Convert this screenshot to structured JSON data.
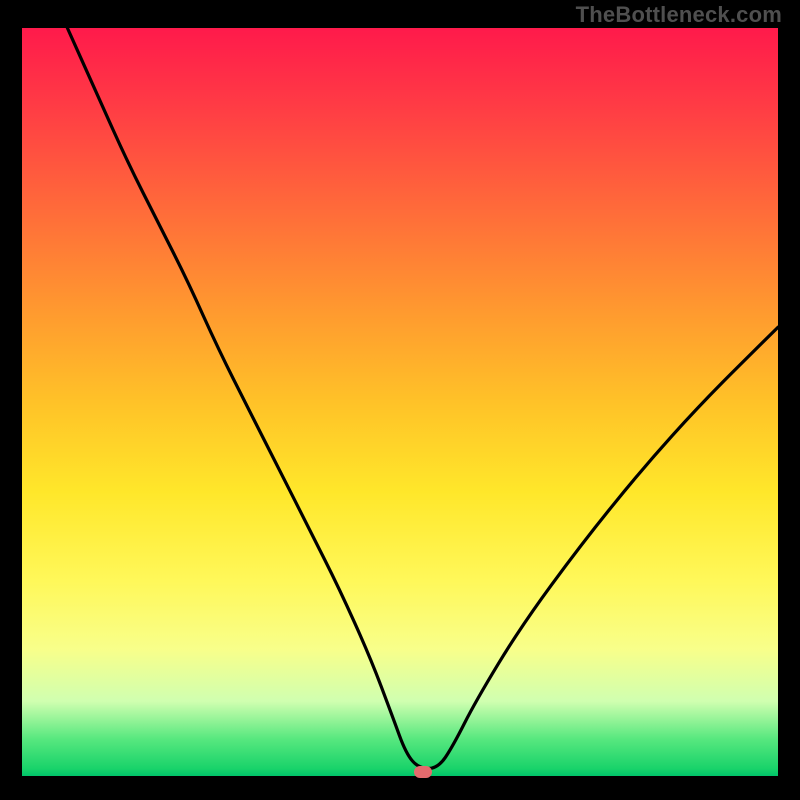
{
  "watermark": "TheBottleneck.com",
  "chart_data": {
    "type": "line",
    "title": "",
    "xlabel": "",
    "ylabel": "",
    "xlim": [
      0,
      100
    ],
    "ylim": [
      0,
      100
    ],
    "grid": false,
    "legend": false,
    "series": [
      {
        "name": "bottleneck-curve",
        "x": [
          6,
          10,
          14,
          18,
          22,
          26,
          30,
          34,
          38,
          42,
          46,
          49,
          50.8,
          52.5,
          55,
          57,
          60,
          66,
          74,
          82,
          90,
          100
        ],
        "y": [
          100,
          91,
          82,
          74,
          66,
          57,
          49,
          41,
          33,
          25,
          16,
          8,
          3,
          1,
          1,
          4,
          10,
          20,
          31,
          41,
          50,
          60
        ]
      }
    ],
    "marker": {
      "x": 53,
      "y": 0.6,
      "color": "#e46a6d"
    },
    "gradient_stops": [
      {
        "pct": 0,
        "color": "#ff1a4b"
      },
      {
        "pct": 10,
        "color": "#ff3a45"
      },
      {
        "pct": 24,
        "color": "#ff6a3a"
      },
      {
        "pct": 38,
        "color": "#ff9a2f"
      },
      {
        "pct": 50,
        "color": "#ffc228"
      },
      {
        "pct": 62,
        "color": "#ffe72a"
      },
      {
        "pct": 74,
        "color": "#fff85a"
      },
      {
        "pct": 83,
        "color": "#f8ff8a"
      },
      {
        "pct": 90,
        "color": "#d0ffb0"
      },
      {
        "pct": 95,
        "color": "#58e87f"
      },
      {
        "pct": 99,
        "color": "#19d36a"
      },
      {
        "pct": 100,
        "color": "#00c46a"
      }
    ]
  }
}
